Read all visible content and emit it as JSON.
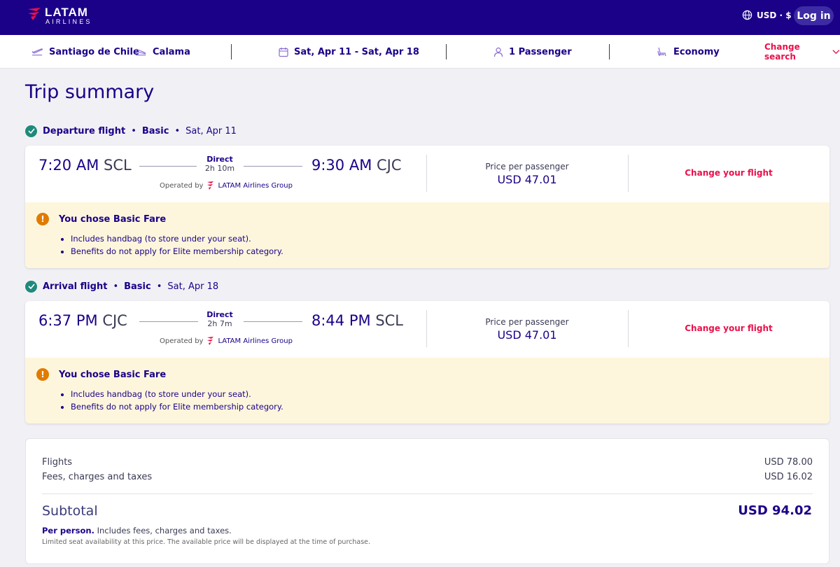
{
  "header": {
    "brand": "LATAM",
    "brand_sub": "AIRLINES",
    "currency": "USD · $",
    "login": "Log in"
  },
  "search": {
    "origin": "Santiago de Chile",
    "destination": "Calama",
    "dates": "Sat, Apr 11 - Sat, Apr 18",
    "passengers": "1 Passenger",
    "cabin": "Economy",
    "change_search": "Change search"
  },
  "page_title": "Trip summary",
  "departure": {
    "type": "Departure flight",
    "fare": "Basic",
    "date": "Sat, Apr 11",
    "dep_time": "7:20 AM",
    "dep_code": "SCL",
    "direct": "Direct",
    "duration": "2h 10m",
    "arr_time": "9:30 AM",
    "arr_code": "CJC",
    "operated_by": "Operated by",
    "operator": "LATAM Airlines Group",
    "price_label": "Price per passenger",
    "price": "USD 47.01",
    "change": "Change your flight",
    "notice_title": "You chose Basic Fare",
    "notice_items": [
      "Includes handbag (to store under your seat).",
      "Benefits do not apply for Elite membership category."
    ]
  },
  "arrival": {
    "type": "Arrival flight",
    "fare": "Basic",
    "date": "Sat, Apr 18",
    "dep_time": "6:37 PM",
    "dep_code": "CJC",
    "direct": "Direct",
    "duration": "2h 7m",
    "arr_time": "8:44 PM",
    "arr_code": "SCL",
    "operated_by": "Operated by",
    "operator": "LATAM Airlines Group",
    "price_label": "Price per passenger",
    "price": "USD 47.01",
    "change": "Change your flight",
    "notice_title": "You chose Basic Fare",
    "notice_items": [
      "Includes handbag (to store under your seat).",
      "Benefits do not apply for Elite membership category."
    ]
  },
  "summary": {
    "flights_label": "Flights",
    "flights_value": "USD 78.00",
    "fees_label": "Fees, charges and taxes",
    "fees_value": "USD 16.02",
    "subtotal_label": "Subtotal",
    "subtotal_value": "USD 94.02",
    "per_person_bold": "Per person.",
    "per_person_text": " Includes fees, charges and taxes.",
    "limited": "Limited seat availability at this price. The available price will be displayed at the time of purchase."
  },
  "colors": {
    "brand": "#1b0088",
    "accent": "#e8114b",
    "check": "#1f8a7a",
    "warning": "#e07b00",
    "notice_bg": "#fdf6dd"
  }
}
